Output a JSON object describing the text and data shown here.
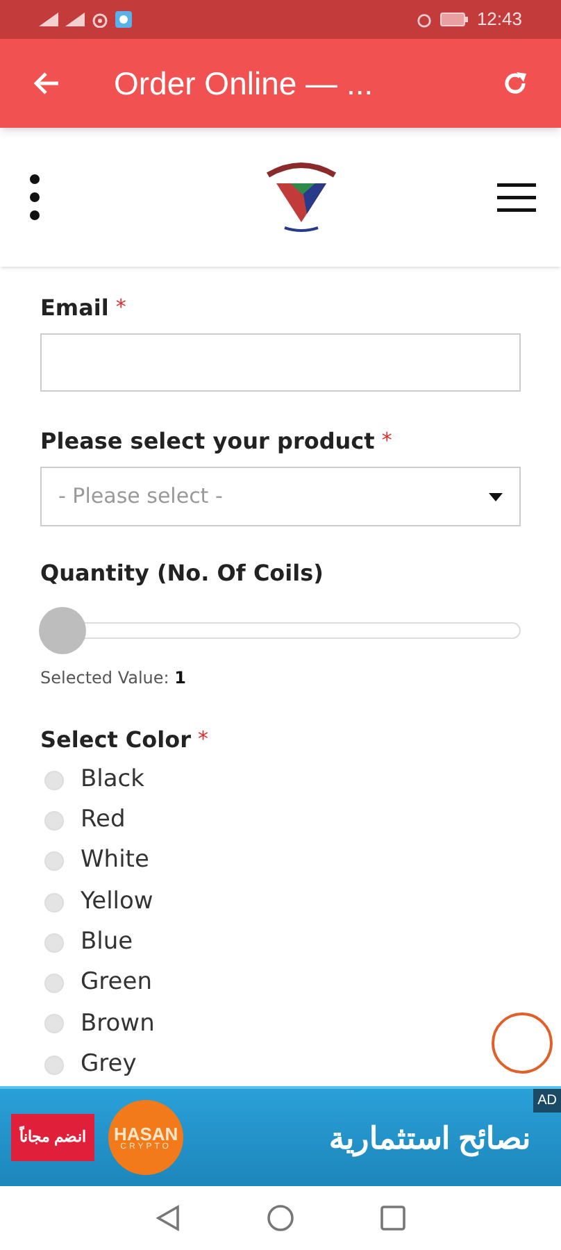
{
  "status_bar": {
    "time": "12:43"
  },
  "app_bar": {
    "title": "Order Online — ..."
  },
  "form": {
    "email": {
      "label": "Email",
      "required_mark": "*"
    },
    "product": {
      "label": "Please select your product",
      "required_mark": "*",
      "placeholder": "- Please select -"
    },
    "quantity": {
      "label": "Quantity (No. Of Coils)",
      "level": 0,
      "caption": "Selected Value:",
      "value": "1"
    },
    "color": {
      "label": "Select Color",
      "required_mark": "*",
      "options": [
        {
          "label": "Black",
          "selected": false
        },
        {
          "label": "Red",
          "selected": false
        },
        {
          "label": "White",
          "selected": false
        },
        {
          "label": "Yellow",
          "selected": false
        },
        {
          "label": "Blue",
          "selected": false
        },
        {
          "label": "Green",
          "selected": false
        },
        {
          "label": "Brown",
          "selected": false
        },
        {
          "label": "Grey",
          "selected": false
        }
      ]
    }
  },
  "ad": {
    "badge": "AD",
    "headline": "نصائح استثمارية",
    "brand": "HASAN",
    "brand_sub": "CRYPTO",
    "button": "انضم مجاناً"
  }
}
